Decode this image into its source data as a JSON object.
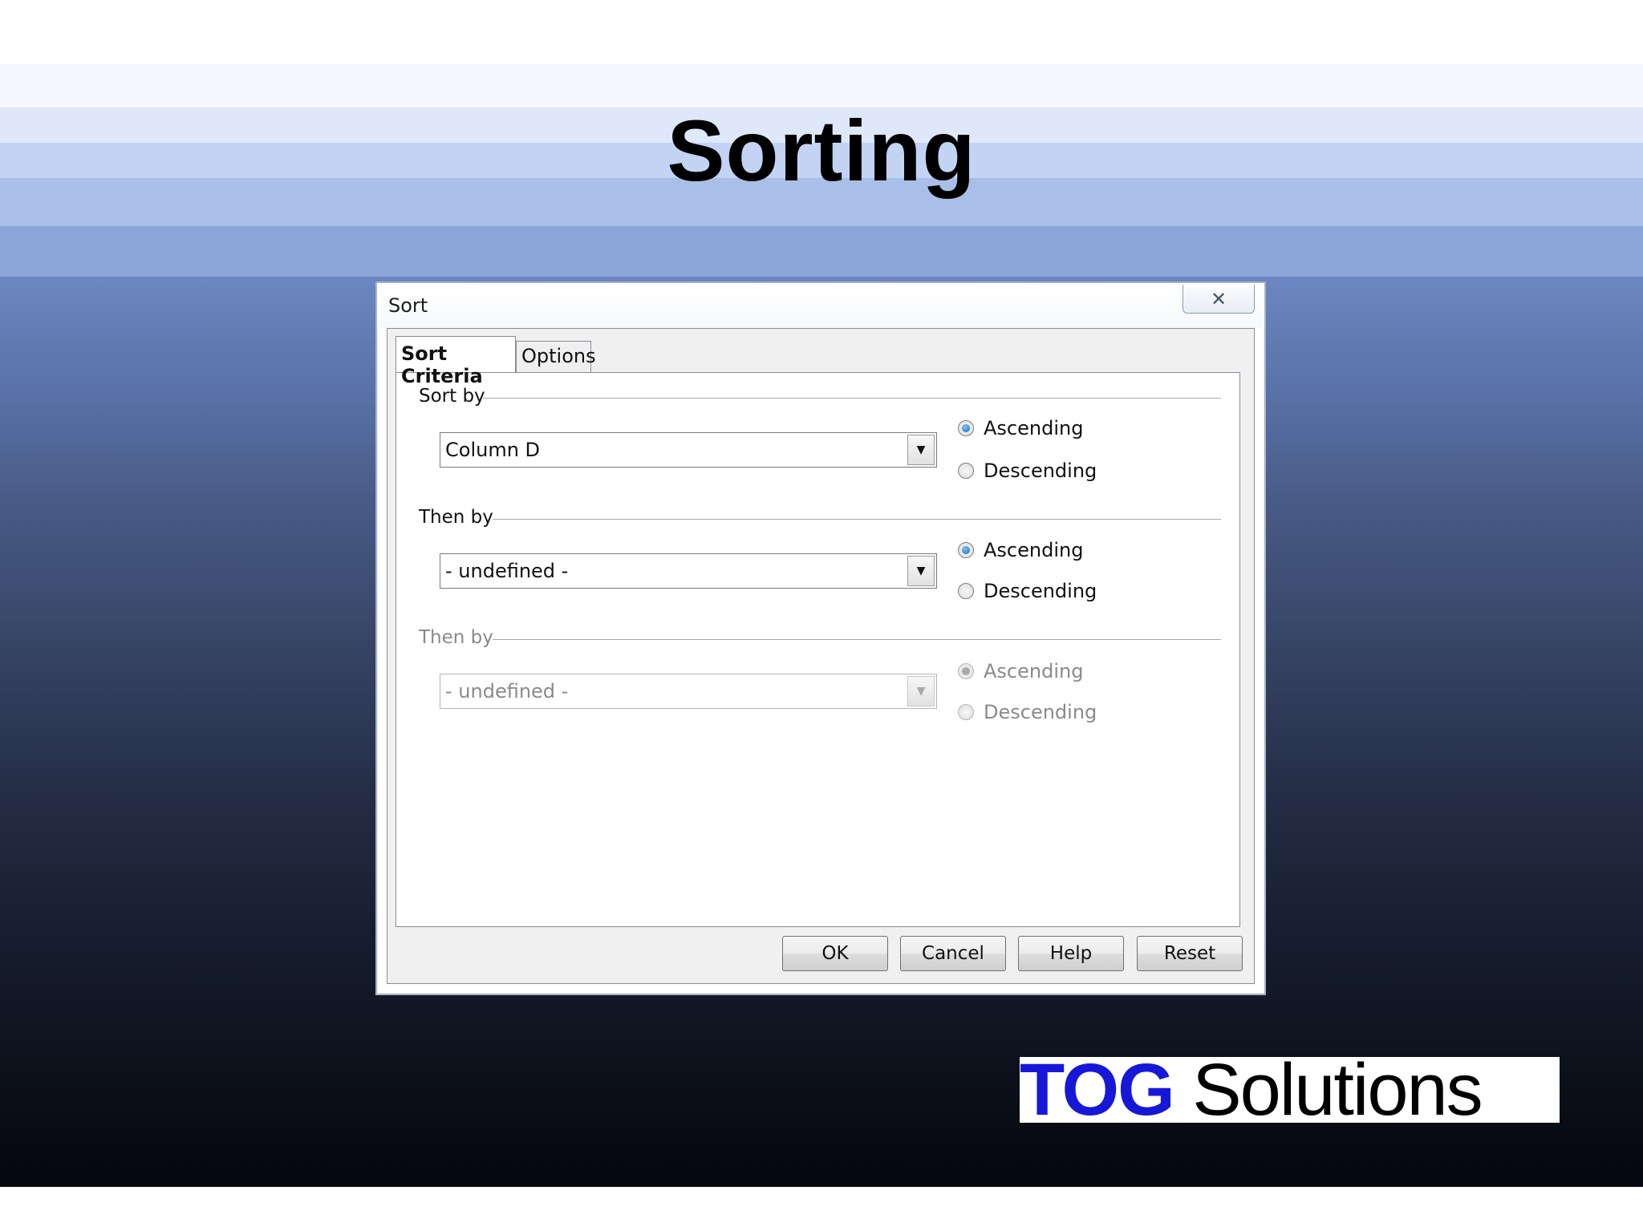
{
  "slide": {
    "title": "Sorting",
    "logo": {
      "tog": "TOG",
      "solutions": "Solutions"
    }
  },
  "dialog": {
    "title": "Sort",
    "tabs": [
      {
        "label": "Sort Criteria"
      },
      {
        "label": "Options"
      }
    ],
    "groups": [
      {
        "label": "Sort by",
        "combo_value": "Column D",
        "ascending": "Ascending",
        "descending": "Descending",
        "selected": "ascending",
        "enabled": true
      },
      {
        "label": "Then by",
        "combo_value": "- undefined -",
        "ascending": "Ascending",
        "descending": "Descending",
        "selected": "ascending",
        "enabled": true
      },
      {
        "label": "Then by",
        "combo_value": "- undefined -",
        "ascending": "Ascending",
        "descending": "Descending",
        "selected": "ascending",
        "enabled": false
      }
    ],
    "buttons": {
      "ok": "OK",
      "cancel": "Cancel",
      "help": "Help",
      "reset": "Reset"
    }
  }
}
